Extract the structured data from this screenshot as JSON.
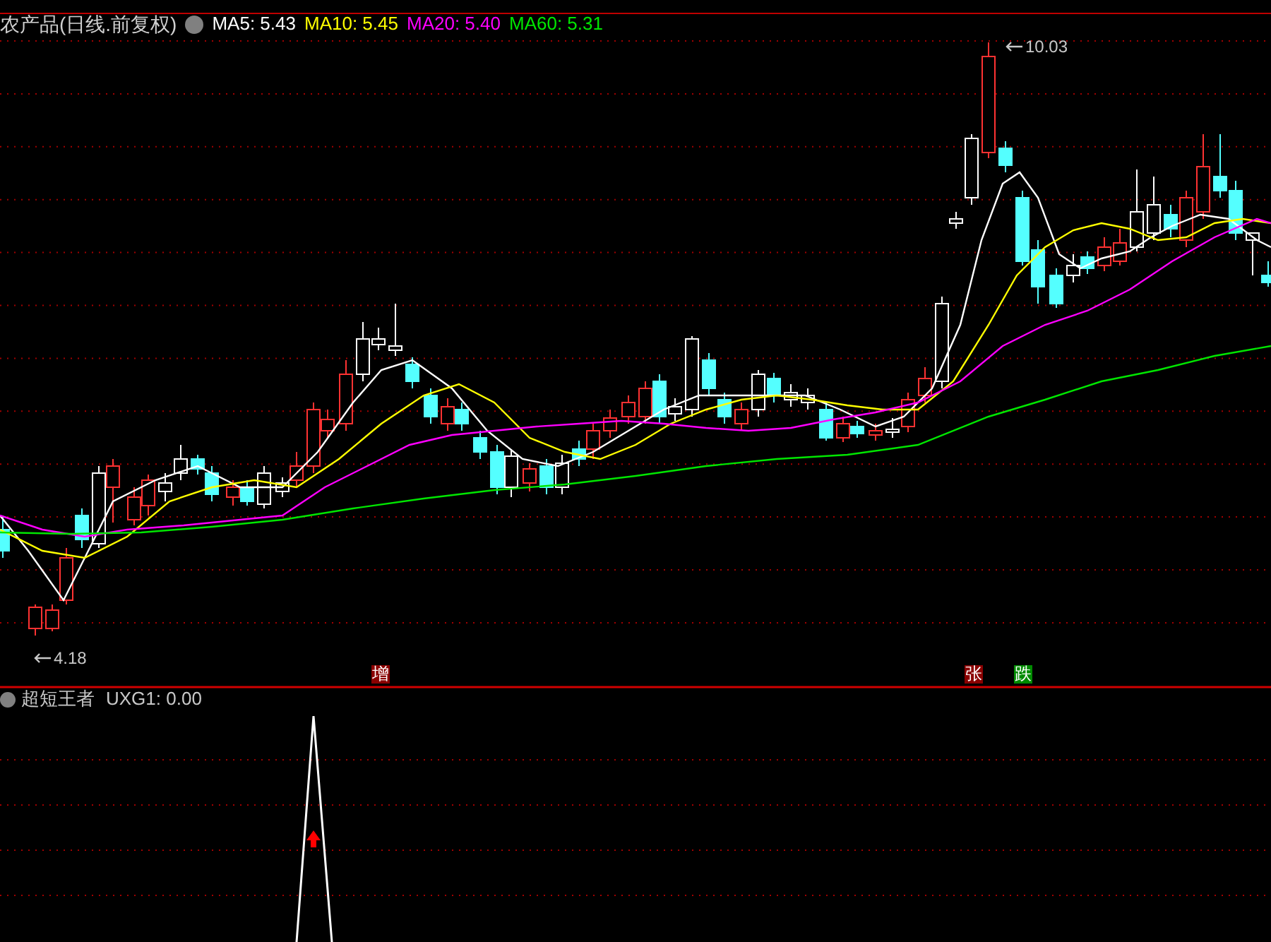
{
  "chart_title": "农产品(日线.前复权)",
  "moving_averages": [
    {
      "label": "MA5:",
      "value": "5.43",
      "color": "#ffffff"
    },
    {
      "label": "MA10:",
      "value": "5.45",
      "color": "#ffff00"
    },
    {
      "label": "MA20:",
      "value": "5.40",
      "color": "#ff00ff"
    },
    {
      "label": "MA60:",
      "value": "5.31",
      "color": "#00e600"
    }
  ],
  "price_labels": {
    "high": "10.03",
    "low": "4.18"
  },
  "signal_markers": [
    {
      "text": "增",
      "kind": "up"
    },
    {
      "text": "张",
      "kind": "up"
    },
    {
      "text": "跌",
      "kind": "down"
    }
  ],
  "indicator": {
    "name": "超短王者",
    "reading": "UXG1: 0.00"
  }
}
